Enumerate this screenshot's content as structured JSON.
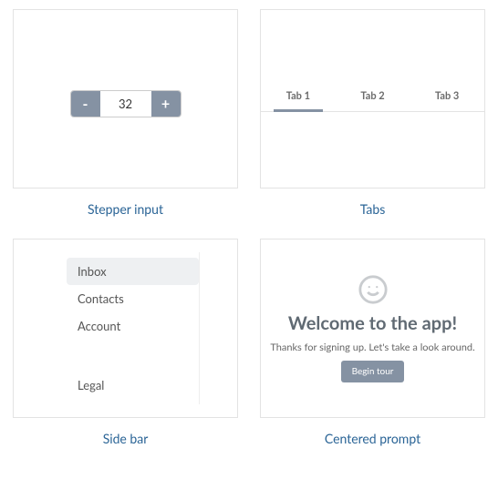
{
  "stepper": {
    "minus": "-",
    "plus": "+",
    "value": "32",
    "caption": "Stepper input"
  },
  "tabs": {
    "items": [
      "Tab 1",
      "Tab 2",
      "Tab 3"
    ],
    "caption": "Tabs"
  },
  "sidebar": {
    "top": [
      "Inbox",
      "Contacts",
      "Account"
    ],
    "bottom": [
      "Legal"
    ],
    "caption": "Side bar"
  },
  "prompt": {
    "title": "Welcome to the app!",
    "body": "Thanks for signing up. Let's take a look around.",
    "button": "Begin tour",
    "caption": "Centered prompt"
  }
}
